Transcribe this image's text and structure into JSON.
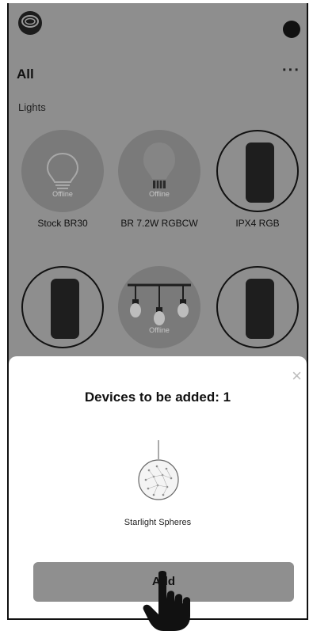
{
  "header": {
    "logo_icon": "app-logo-icon",
    "avatar_icon": "profile-dot-icon"
  },
  "home": {
    "title": "All",
    "more_label": "···",
    "section_label": "Lights"
  },
  "devices": [
    {
      "name": "Stock BR30",
      "status": "Offline",
      "icon": "bulb-icon"
    },
    {
      "name": "BR 7.2W RGBCW",
      "status": "Offline",
      "icon": "bulb-icon"
    },
    {
      "name": "IPX4 RGB",
      "status": "",
      "icon": "strip-controller-icon"
    },
    {
      "name": "",
      "status": "",
      "icon": "strip-controller-icon"
    },
    {
      "name": "",
      "status": "Offline",
      "icon": "string-lights-icon"
    },
    {
      "name": "",
      "status": "",
      "icon": "strip-controller-icon"
    }
  ],
  "sheet": {
    "title": "Devices to be added: 1",
    "close_label": "×",
    "device_name": "Starlight Spheres",
    "device_icon": "sphere-light-icon",
    "add_label": "Add",
    "pointer_icon": "hand-pointer-icon"
  }
}
